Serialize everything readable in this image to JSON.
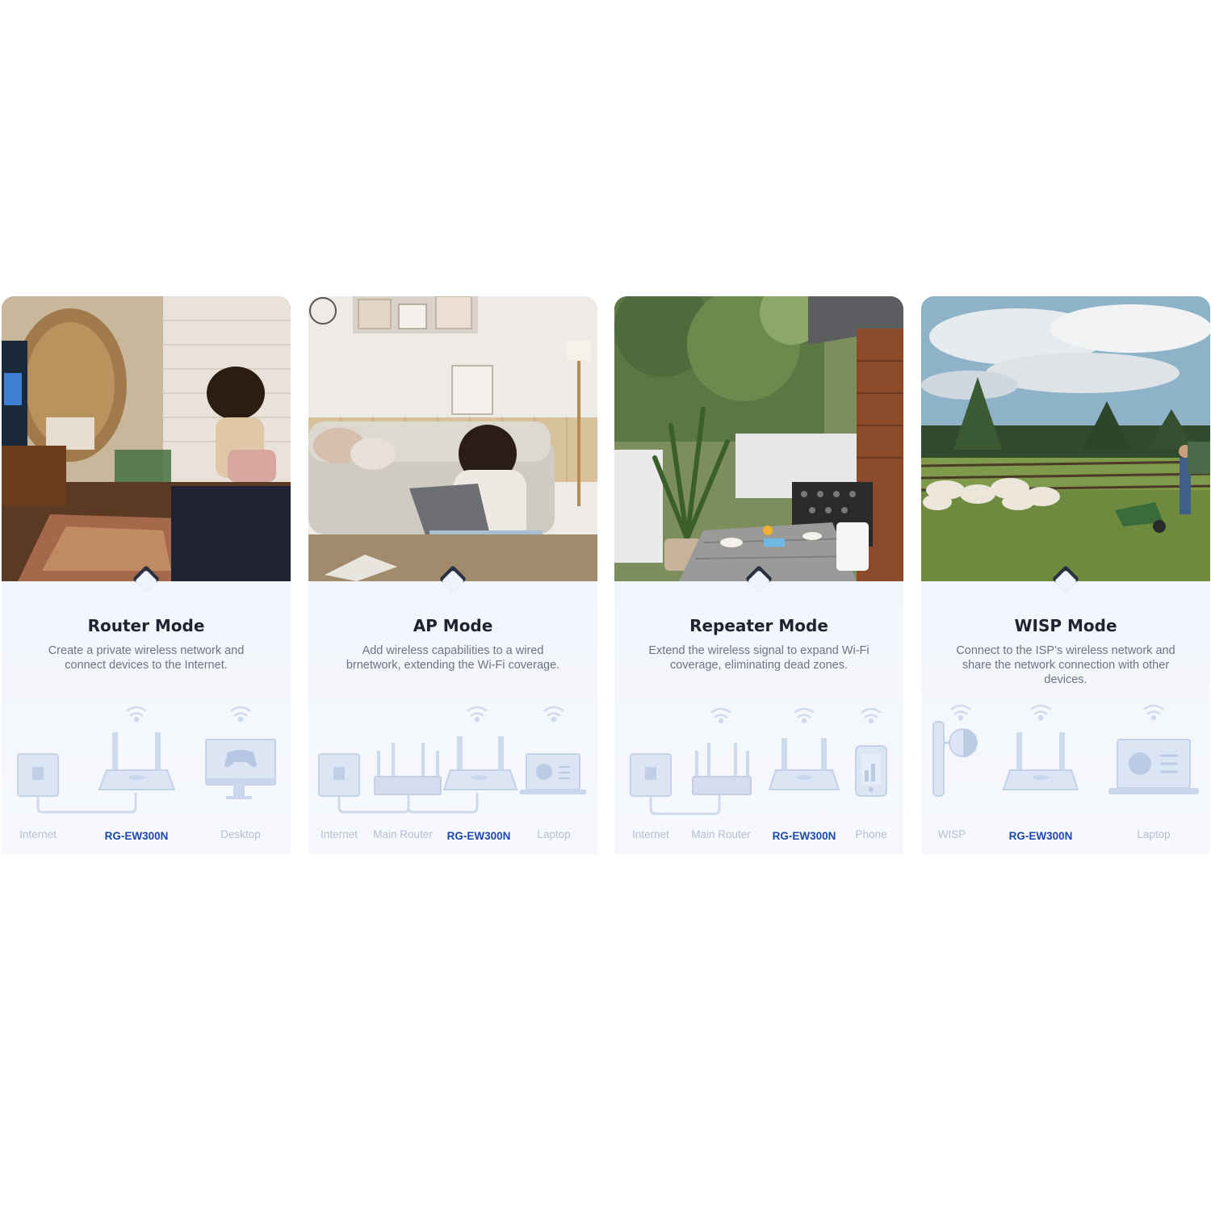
{
  "cards": [
    {
      "title": "Router Mode",
      "desc": "Create a private wireless network and connect devices to the Internet.",
      "labels": [
        "Internet",
        "RG-EW300N",
        "Desktop"
      ],
      "icons": [
        "wall-socket-icon",
        "router-icon",
        "desktop-gamepad-icon"
      ]
    },
    {
      "title": "AP Mode",
      "desc": "Add wireless capabilities to a wired brnetwork, extending the Wi-Fi coverage.",
      "labels": [
        "Internet",
        "Main Router",
        "RG-EW300N",
        "Laptop"
      ],
      "icons": [
        "wall-socket-icon",
        "main-router-icon",
        "router-icon",
        "laptop-icon"
      ]
    },
    {
      "title": "Repeater Mode",
      "desc": "Extend the wireless signal to expand Wi-Fi coverage, eliminating dead zones.",
      "labels": [
        "Internet",
        "Main Router",
        "RG-EW300N",
        "Phone"
      ],
      "icons": [
        "wall-socket-icon",
        "main-router-icon",
        "router-icon",
        "phone-icon"
      ]
    },
    {
      "title": "WISP Mode",
      "desc": "Connect to the ISP’s wireless network and share the network connection with other devices.",
      "labels": [
        "WISP",
        "RG-EW300N",
        "Laptop"
      ],
      "icons": [
        "wisp-antenna-icon",
        "router-icon",
        "laptop-icon"
      ]
    }
  ],
  "colors": {
    "accent": "#1f49a8",
    "title": "#1d2330",
    "muted_label": "#b4bfd3",
    "diagram_fill": "#dbe4f3",
    "diagram_stroke": "#bccbe4"
  }
}
